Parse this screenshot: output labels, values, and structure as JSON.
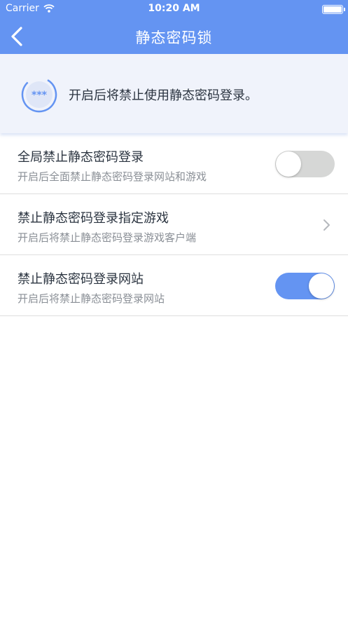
{
  "status_bar": {
    "carrier": "Carrier",
    "time": "10:20 AM"
  },
  "nav": {
    "title": "静态密码锁",
    "back_icon": "chevron-left-icon"
  },
  "banner": {
    "text": "开启后将禁止使用静态密码登录。",
    "icon": "password-lock-icon",
    "icon_symbol": "***"
  },
  "settings": [
    {
      "title": "全局禁止静态密码登录",
      "subtitle": "开启后全面禁止静态密码登录网站和游戏",
      "control": "toggle",
      "checked": false
    },
    {
      "title": "禁止静态密码登录指定游戏",
      "subtitle": "开启后将禁止静态密码登录游戏客户端",
      "control": "chevron"
    },
    {
      "title": "禁止静态密码登录网站",
      "subtitle": "开启后将禁止静态密码登录网站",
      "control": "toggle",
      "checked": true
    }
  ],
  "colors": {
    "accent": "#6494f2",
    "toggle_off": "#d6d7d6",
    "banner_bg": "#f0f3fb"
  }
}
